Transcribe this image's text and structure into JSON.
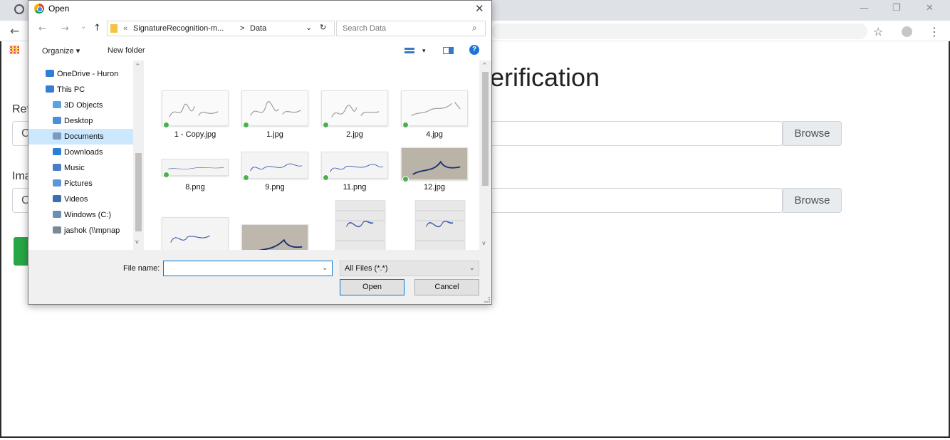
{
  "browser": {
    "back_glyph": "←",
    "star_glyph": "☆",
    "menu_glyph": "⋮",
    "minimize_glyph": "—",
    "restore_glyph": "❐",
    "close_glyph": "✕",
    "apps_glyph": "⋮⋮⋮"
  },
  "page": {
    "title_partial": "erification",
    "reference_label_partial": "Ref",
    "image_label_partial": "Ima",
    "input_stub_1": "C",
    "input_stub_2": "C",
    "browse_label_1": "Browse",
    "browse_label_2": "Browse",
    "accent_green": "#28a745"
  },
  "dialog": {
    "title": "Open",
    "close_glyph": "✕",
    "nav": {
      "back": "←",
      "forward": "→",
      "recent": "⌄",
      "up": "↑"
    },
    "path": {
      "overflow": "«",
      "segment_1": "SignatureRecognition-m...",
      "separator": ">",
      "segment_2": "Data",
      "dropdown": "⌄",
      "refresh": "↻"
    },
    "search": {
      "placeholder": "Search Data",
      "icon": "⌕"
    },
    "toolbar": {
      "organize": "Organize ▾",
      "new_folder": "New folder",
      "view_caret": "▾",
      "help": "?"
    },
    "sidebar": [
      {
        "label": "OneDrive - Huron",
        "icon": "onedrive-icon",
        "color": "#2f7fd6"
      },
      {
        "label": "This PC",
        "icon": "computer-icon",
        "color": "#3a7bd5"
      },
      {
        "label": "3D Objects",
        "icon": "cube-icon",
        "color": "#5ba3e0"
      },
      {
        "label": "Desktop",
        "icon": "desktop-icon",
        "color": "#4a90d9"
      },
      {
        "label": "Documents",
        "icon": "documents-icon",
        "color": "#7b9bbd"
      },
      {
        "label": "Downloads",
        "icon": "downloads-icon",
        "color": "#2d7fd3"
      },
      {
        "label": "Music",
        "icon": "music-icon",
        "color": "#4a7fc8"
      },
      {
        "label": "Pictures",
        "icon": "pictures-icon",
        "color": "#5a97d8"
      },
      {
        "label": "Videos",
        "icon": "videos-icon",
        "color": "#3b6fb0"
      },
      {
        "label": "Windows (C:)",
        "icon": "drive-icon",
        "color": "#6a8fb5"
      },
      {
        "label": "jashok (\\\\mpnap",
        "icon": "network-drive-icon",
        "color": "#7a8a96"
      }
    ],
    "selected_sidebar": "Documents",
    "files": [
      {
        "name": "1 - Copy.jpg"
      },
      {
        "name": "1.jpg"
      },
      {
        "name": "2.jpg"
      },
      {
        "name": "4.jpg"
      },
      {
        "name": "8.png"
      },
      {
        "name": "9.png"
      },
      {
        "name": "11.png"
      },
      {
        "name": "12.jpg"
      },
      {
        "name": ""
      },
      {
        "name": ""
      },
      {
        "name": ""
      },
      {
        "name": ""
      }
    ],
    "file_name_label": "File name:",
    "file_name_value": "",
    "file_type": "All Files (*.*)",
    "open_label": "Open",
    "cancel_label": "Cancel"
  }
}
